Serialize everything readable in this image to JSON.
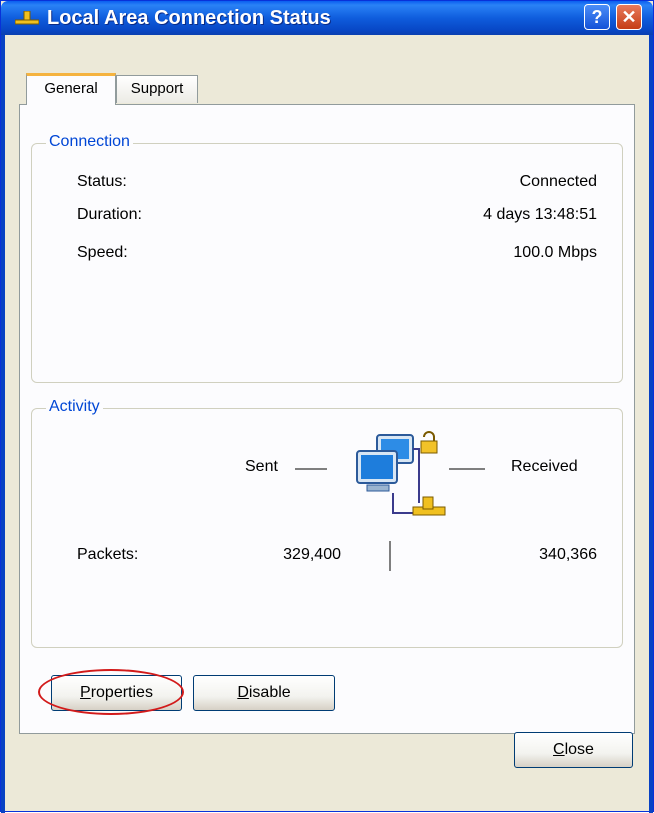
{
  "window": {
    "title": "Local Area Connection Status"
  },
  "titlebar_buttons": {
    "help": "?",
    "close": "✕"
  },
  "tabs": [
    {
      "label": "General",
      "active": true
    },
    {
      "label": "Support",
      "active": false
    }
  ],
  "connection": {
    "legend": "Connection",
    "rows": [
      {
        "label": "Status:",
        "value": "Connected"
      },
      {
        "label": "Duration:",
        "value": "4 days 13:48:51"
      },
      {
        "label": "Speed:",
        "value": "100.0 Mbps"
      }
    ]
  },
  "activity": {
    "legend": "Activity",
    "sent_label": "Sent",
    "received_label": "Received",
    "packets_label": "Packets:",
    "packets_sent": "329,400",
    "packets_received": "340,366",
    "icon": "network-computers-lock-icon"
  },
  "buttons": {
    "properties": {
      "label": "Properties",
      "accel": "P",
      "rest": "roperties"
    },
    "disable": {
      "label": "Disable",
      "accel": "D",
      "rest": "isable"
    },
    "close": {
      "label": "Close",
      "accel": "C",
      "rest": "lose"
    }
  },
  "colors": {
    "titlebar": "#0a5ef0",
    "legend": "#0046d5",
    "tab_highlight": "#f5b33f",
    "annotation": "#d21a1a"
  }
}
